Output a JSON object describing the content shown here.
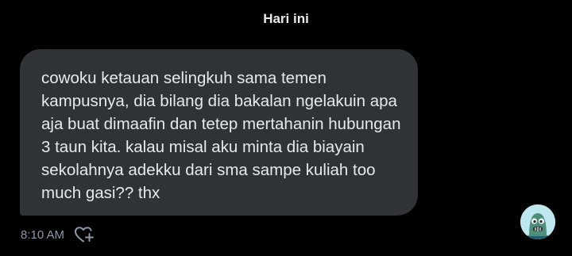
{
  "date_separator": "Hari ini",
  "message": {
    "text": "cowoku ketauan selingkuh sama temen kampusnya, dia bilang dia bakalan ngelakuin apa aja buat dimaafin dan tetep mertahanin hubungan 3 taun kita. kalau misal aku minta dia biayain sekolahnya adekku dari sma sampe kuliah too much gasi?? thx",
    "time": "8:10 AM"
  },
  "icons": {
    "react": "heart-plus-icon",
    "avatar": "avatar"
  },
  "colors": {
    "background": "#000000",
    "bubble": "#2f3336",
    "text": "#e7e9ea",
    "muted": "#8b98a5"
  }
}
